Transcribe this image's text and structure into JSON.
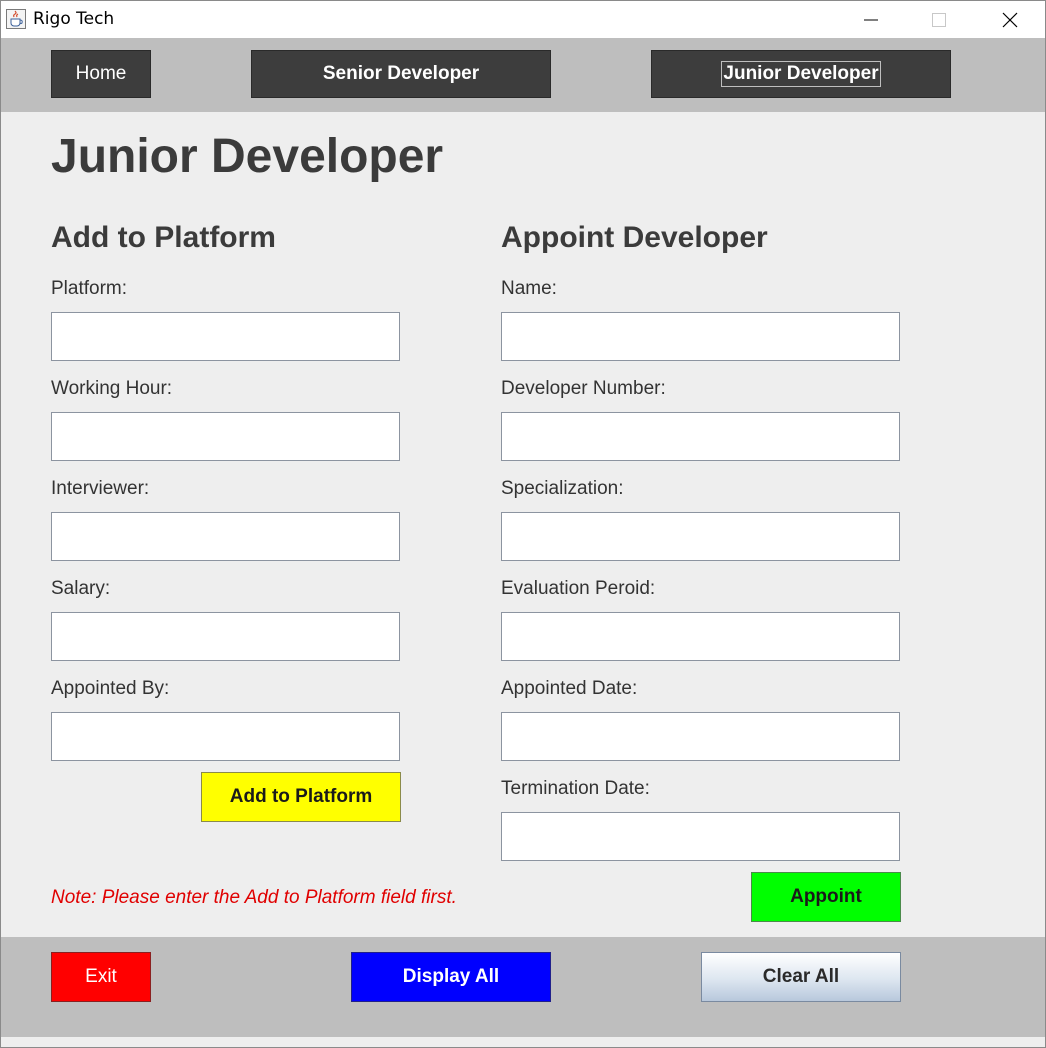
{
  "window": {
    "title": "Rigo Tech"
  },
  "nav": {
    "home": "Home",
    "senior": "Senior Developer",
    "junior": "Junior Developer"
  },
  "page": {
    "title": "Junior Developer"
  },
  "platform_section": {
    "title": "Add to Platform",
    "fields": [
      {
        "label": "Platform:",
        "value": ""
      },
      {
        "label": "Working Hour:",
        "value": ""
      },
      {
        "label": "Interviewer:",
        "value": ""
      },
      {
        "label": "Salary:",
        "value": ""
      },
      {
        "label": "Appointed By:",
        "value": ""
      }
    ],
    "button": "Add to Platform"
  },
  "appoint_section": {
    "title": "Appoint Developer",
    "fields": [
      {
        "label": "Name:",
        "value": ""
      },
      {
        "label": "Developer Number:",
        "value": ""
      },
      {
        "label": "Specialization:",
        "value": ""
      },
      {
        "label": "Evaluation Peroid:",
        "value": ""
      },
      {
        "label": "Appointed Date:",
        "value": ""
      },
      {
        "label": "Termination Date:",
        "value": ""
      }
    ],
    "button": "Appoint"
  },
  "note": "Note: Please enter the Add to Platform field first.",
  "footer": {
    "exit": "Exit",
    "display_all": "Display All",
    "clear_all": "Clear All"
  },
  "colors": {
    "nav_bg": "#bebebe",
    "nav_button": "#3d3d3d",
    "add_button": "#ffff00",
    "appoint_button": "#00ff00",
    "exit_button": "#ff0000",
    "display_button": "#0000ff",
    "note_text": "#e00000"
  },
  "icons": {
    "app": "java-cup-icon",
    "minimize": "minimize-icon",
    "maximize": "maximize-icon",
    "close": "close-icon"
  }
}
